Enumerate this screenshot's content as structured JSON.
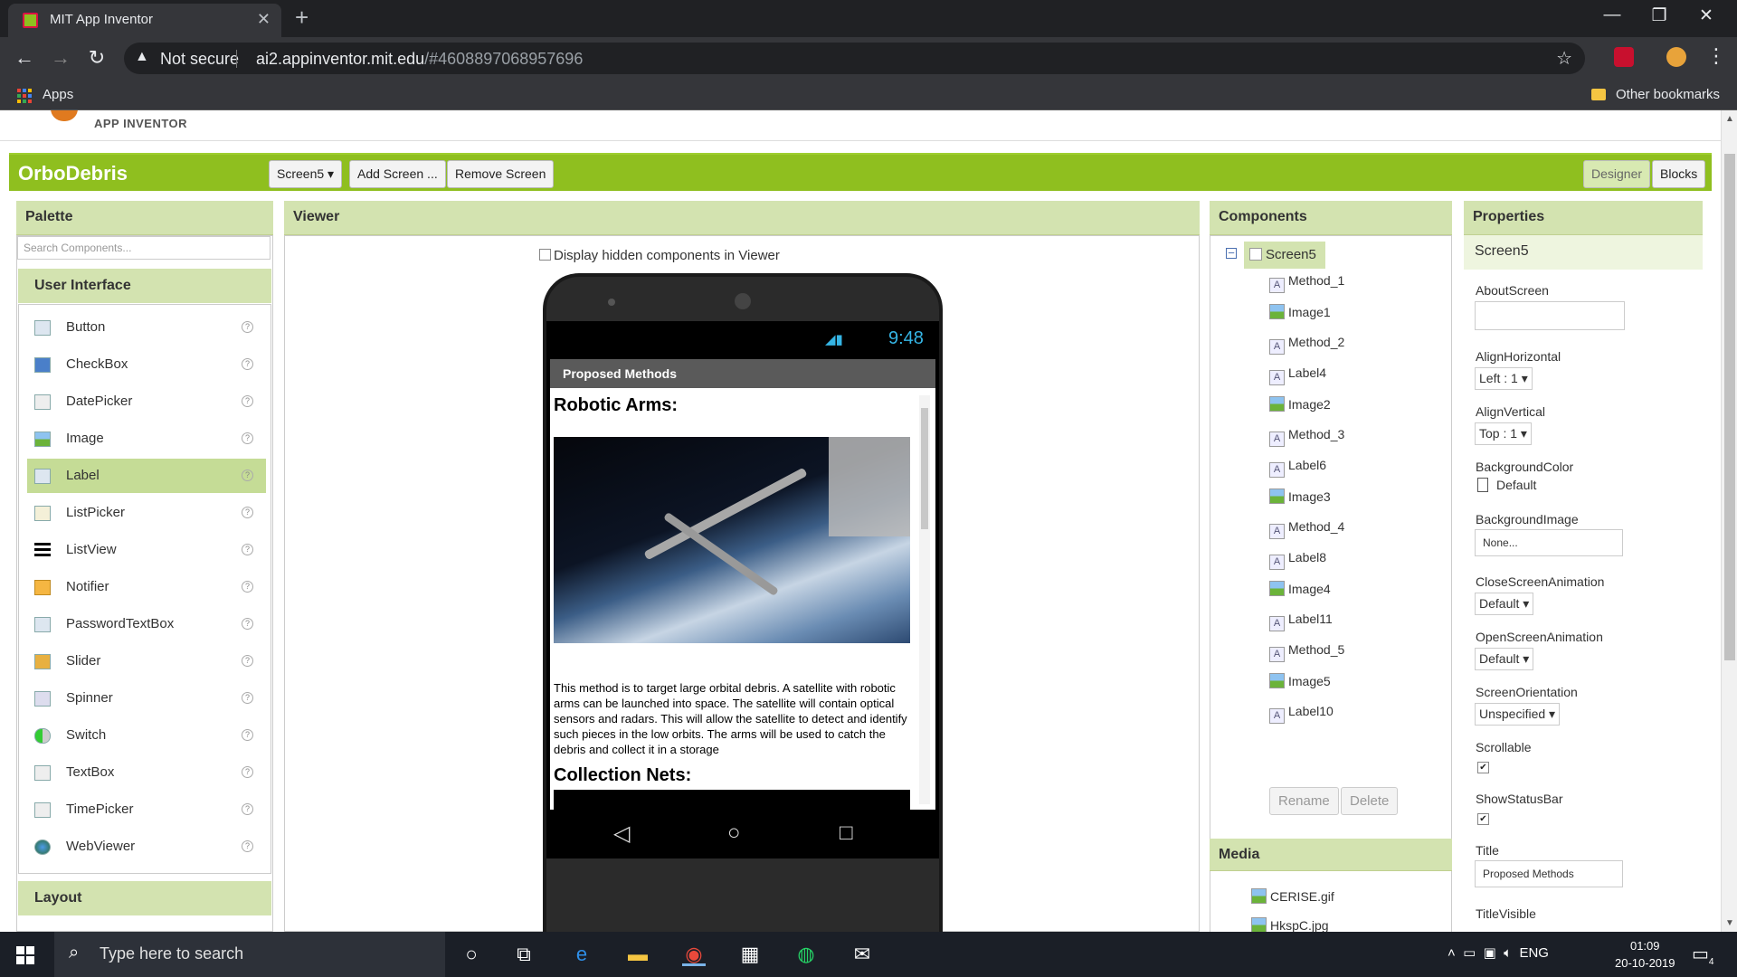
{
  "browser": {
    "tab_title": "MIT App Inventor",
    "tab_close": "✕",
    "new_tab": "+",
    "not_secure": "Not secure",
    "url_host": "ai2.appinventor.mit.edu",
    "url_path": "/#4608897068957696",
    "apps_label": "Apps",
    "other_bookmarks": "Other bookmarks"
  },
  "appinventor": {
    "brand": "APP INVENTOR",
    "project_name": "OrboDebris",
    "screen_dropdown": "Screen5 ▾",
    "add_screen": "Add Screen ...",
    "remove_screen": "Remove Screen",
    "designer": "Designer",
    "blocks": "Blocks"
  },
  "palette": {
    "title": "Palette",
    "search_placeholder": "Search Components...",
    "section_ui": "User Interface",
    "section_layout": "Layout",
    "items": [
      "Button",
      "CheckBox",
      "DatePicker",
      "Image",
      "Label",
      "ListPicker",
      "ListView",
      "Notifier",
      "PasswordTextBox",
      "Slider",
      "Spinner",
      "Switch",
      "TextBox",
      "TimePicker",
      "WebViewer"
    ],
    "help": "?"
  },
  "viewer": {
    "title": "Viewer",
    "hidden_checkbox_label": "Display hidden components in Viewer",
    "status_time": "9:48",
    "screen_title": "Proposed Methods",
    "heading1": "Robotic Arms:",
    "body1": "This method is to target large orbital debris. A satellite with robotic arms can be launched into space. The satellite will contain optical sensors and radars. This will allow the satellite to detect and identify such pieces in the low orbits. The arms will be used to catch the debris and collect it in a storage",
    "heading2": "Collection Nets:"
  },
  "components": {
    "title": "Components",
    "root": "Screen5",
    "items": [
      "Method_1",
      "Image1",
      "Method_2",
      "Label4",
      "Image2",
      "Method_3",
      "Label6",
      "Image3",
      "Method_4",
      "Label8",
      "Image4",
      "Label11",
      "Method_5",
      "Image5",
      "Label10"
    ],
    "rename": "Rename",
    "delete": "Delete"
  },
  "media": {
    "title": "Media",
    "items": [
      "CERISE.gif",
      "HkspC.jpg"
    ]
  },
  "properties": {
    "title": "Properties",
    "subject": "Screen5",
    "about_screen": "AboutScreen",
    "align_horizontal": "AlignHorizontal",
    "align_horizontal_value": "Left : 1 ▾",
    "align_vertical": "AlignVertical",
    "align_vertical_value": "Top : 1 ▾",
    "background_color": "BackgroundColor",
    "background_color_value": "Default",
    "background_image": "BackgroundImage",
    "background_image_value": "None...",
    "close_anim": "CloseScreenAnimation",
    "close_anim_value": "Default ▾",
    "open_anim": "OpenScreenAnimation",
    "open_anim_value": "Default ▾",
    "orientation": "ScreenOrientation",
    "orientation_value": "Unspecified ▾",
    "scrollable": "Scrollable",
    "show_status_bar": "ShowStatusBar",
    "title_prop": "Title",
    "title_value": "Proposed Methods",
    "title_visible": "TitleVisible"
  },
  "taskbar": {
    "search_placeholder": "Type here to search",
    "lang": "ENG",
    "time": "01:09",
    "date": "20-10-2019",
    "notif_count": "4"
  },
  "colors": {
    "appinventor_green": "#8fbf1f",
    "panel_header": "#d3e3b0",
    "chrome_dark": "#35363a",
    "taskbar": "#1b1f27"
  }
}
